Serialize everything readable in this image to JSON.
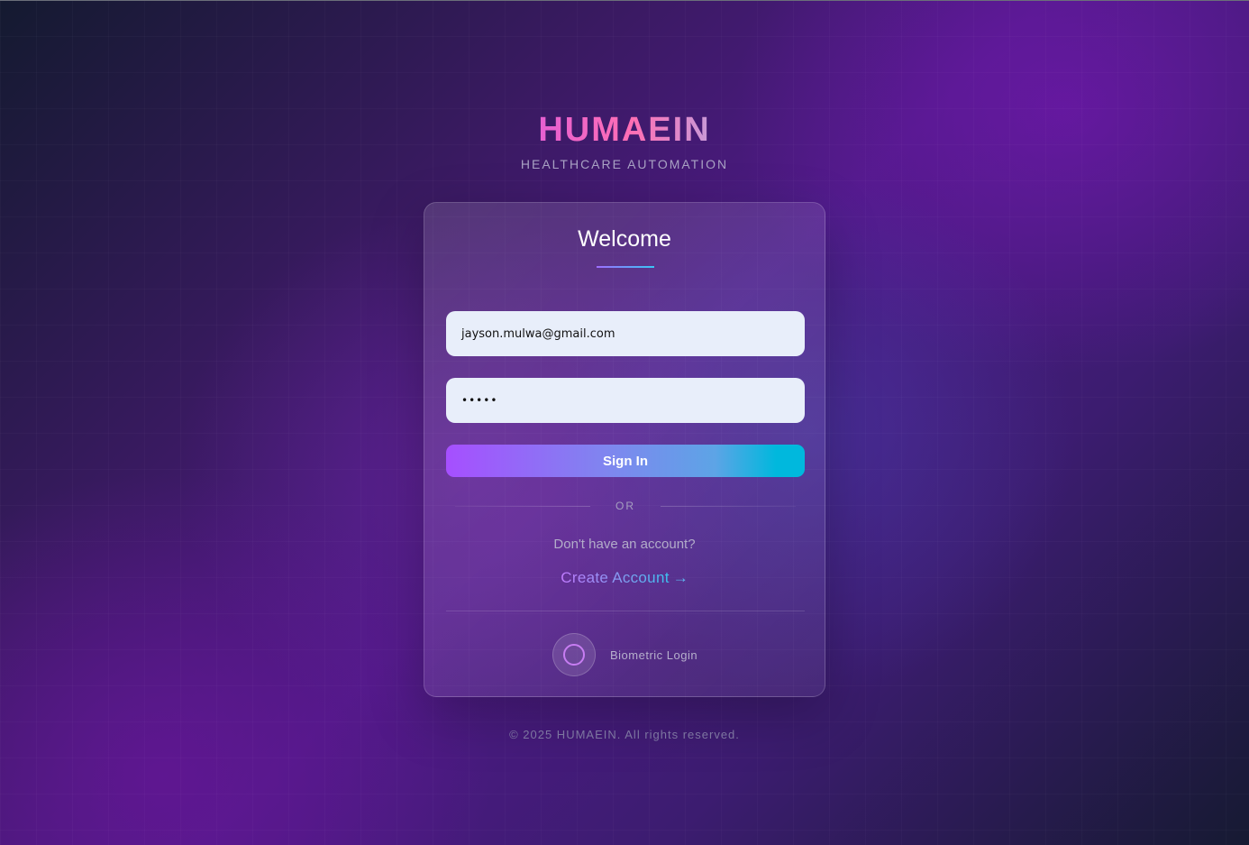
{
  "brand": {
    "title": "HUMAEIN",
    "subtitle": "HEALTHCARE AUTOMATION"
  },
  "card": {
    "heading": "Welcome",
    "email_value": "jayson.mulwa@gmail.com",
    "password_masked": "•••••",
    "signin_label": "Sign In",
    "or_text": "OR",
    "no_account_text": "Don't have an account?",
    "create_account_label": "Create Account",
    "create_account_arrow": "→",
    "biometric_label": "Biometric Login"
  },
  "footer": {
    "copyright": "© 2025 HUMAEIN. All rights reserved."
  },
  "colors": {
    "accent_purple": "#a64fff",
    "accent_cyan": "#00b8dd",
    "brand_pink": "#ff6fb4",
    "input_bg": "#e8eefa"
  },
  "icons": {
    "biometric": "fingerprint-circle-icon",
    "create_arrow": "arrow-right-icon"
  }
}
